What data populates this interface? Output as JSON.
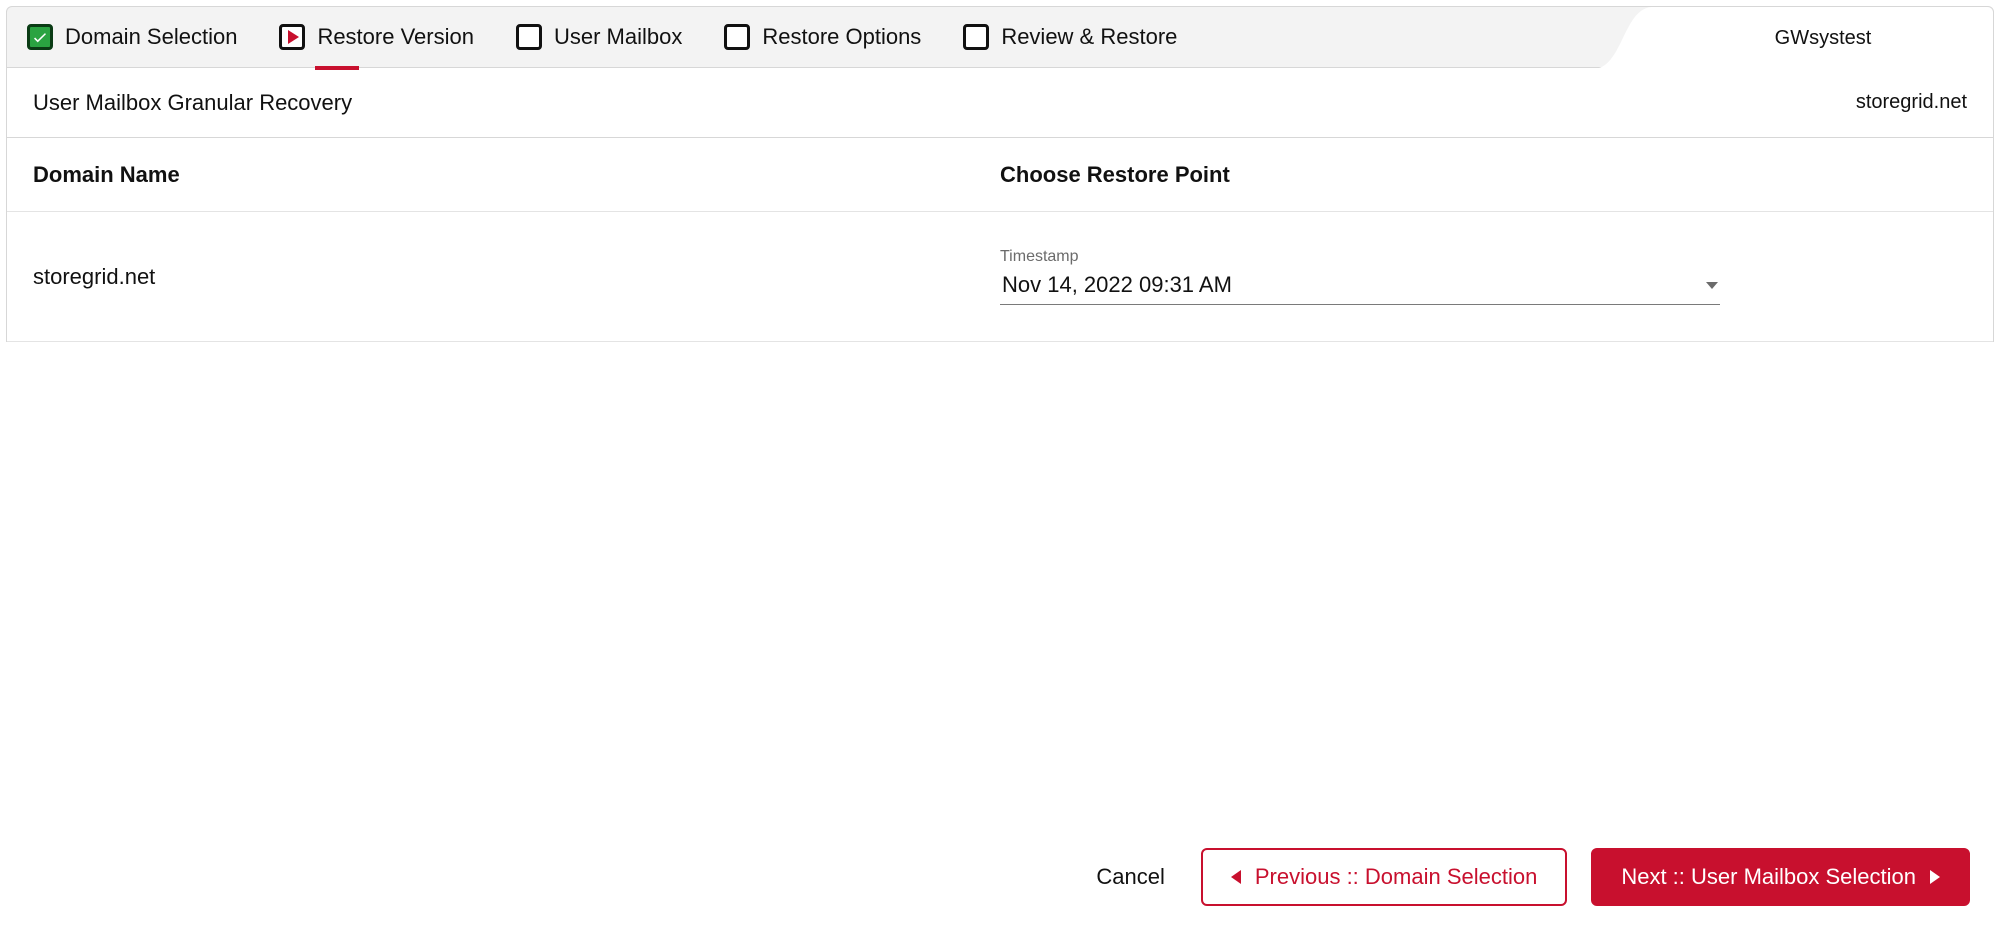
{
  "wizard": {
    "tenant": "GWsystest",
    "steps": [
      {
        "label": "Domain Selection",
        "state": "done"
      },
      {
        "label": "Restore Version",
        "state": "current"
      },
      {
        "label": "User Mailbox",
        "state": "pending"
      },
      {
        "label": "Restore Options",
        "state": "pending"
      },
      {
        "label": "Review & Restore",
        "state": "pending"
      }
    ]
  },
  "header": {
    "title": "User Mailbox Granular Recovery",
    "domain": "storegrid.net"
  },
  "columns": {
    "left": "Domain Name",
    "right": "Choose Restore Point"
  },
  "row": {
    "domain_value": "storegrid.net",
    "timestamp_label": "Timestamp",
    "timestamp_value": "Nov 14, 2022 09:31 AM"
  },
  "footer": {
    "cancel": "Cancel",
    "previous": "Previous :: Domain Selection",
    "next": "Next :: User Mailbox Selection"
  }
}
